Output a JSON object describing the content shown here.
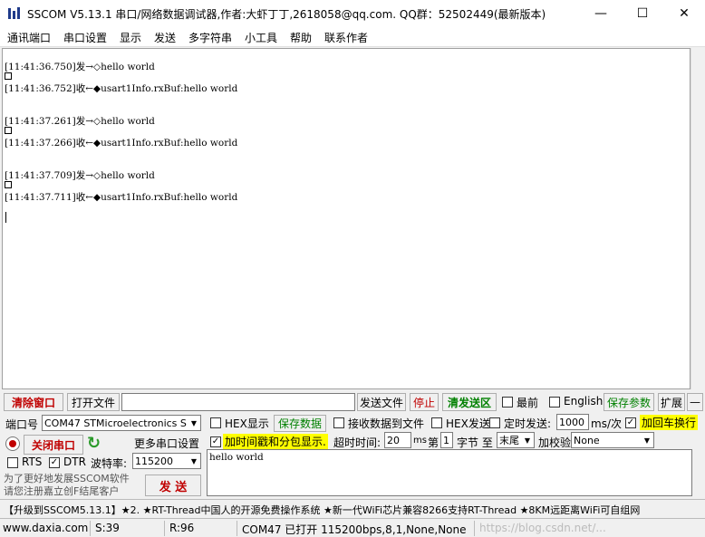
{
  "window": {
    "title": "SSCOM V5.13.1 串口/网络数据调试器,作者:大虾丁丁,2618058@qq.com. QQ群：52502449(最新版本)",
    "min": "—",
    "max": "☐",
    "close": "✕"
  },
  "menu": [
    "通讯端口",
    "串口设置",
    "显示",
    "发送",
    "多字符串",
    "小工具",
    "帮助",
    "联系作者"
  ],
  "recv": {
    "lines": [
      {
        "text": "[11:41:36.750]发→◇hello world"
      },
      {
        "text": "[11:41:36.752]收←◆usart1Info.rxBuf:hello world"
      },
      {
        "text": "[11:41:37.261]发→◇hello world"
      },
      {
        "text": "[11:41:37.266]收←◆usart1Info.rxBuf:hello world"
      },
      {
        "text": "[11:41:37.709]发→◇hello world"
      },
      {
        "text": "[11:41:37.711]收←◆usart1Info.rxBuf:hello world"
      }
    ]
  },
  "toolbar": {
    "clear": "清除窗口",
    "open_file": "打开文件",
    "file_path": "",
    "send_file": "发送文件",
    "stop": "停止",
    "clear_send": "清发送区",
    "topmost": "最前",
    "english": "English",
    "save_params": "保存参数",
    "expand": "扩展",
    "collapse": "—"
  },
  "port": {
    "label": "端口号",
    "value": "COM47 STMicroelectronics S",
    "close_port": "关闭串口",
    "more_settings": "更多串口设置",
    "rts": "RTS",
    "dtr": "DTR",
    "baud_label": "波特率:",
    "baud": "115200",
    "promo": "为了更好地发展SSCOM软件\n请您注册嘉立创F结尾客户",
    "send": "发  送"
  },
  "options": {
    "hex_display": "HEX显示",
    "save_data": "保存数据",
    "recv_to_file": "接收数据到文件",
    "hex_send": "HEX发送",
    "timed_send": "定时发送:",
    "interval": "1000",
    "interval_unit": "ms/次",
    "add_crlf": "加回车换行",
    "timestamp": "加时间戳和分包显示.",
    "timeout_label": "超时时间:",
    "timeout": "20",
    "timeout_unit": "ms",
    "byte_label1": "第",
    "byte_start": "1",
    "byte_label2": "字节 至",
    "byte_end": "末尾",
    "checksum_label": "加校验",
    "checksum": "None"
  },
  "send_text": "hello world",
  "ticker": "【升级到SSCOM5.13.1】★2. ★RT-Thread中国人的开源免费操作系统 ★新一代WiFi芯片兼容8266支持RT-Thread ★8KM远距离WiFi可自组网",
  "status": {
    "site": "www.daxia.com",
    "sent": "S:39",
    "recv": "R:96",
    "port_state": "COM47 已打开  115200bps,8,1,None,None",
    "watermark": "https://blog.csdn.net/..."
  }
}
